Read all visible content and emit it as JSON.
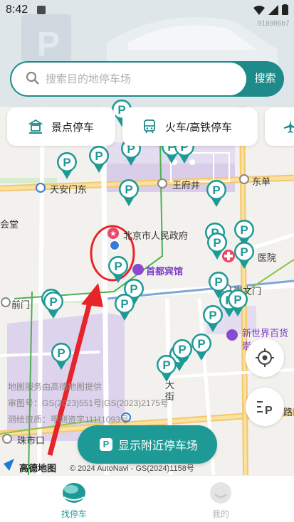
{
  "status_bar": {
    "time": "8:42"
  },
  "search": {
    "placeholder": "搜索目的地停车场",
    "button_label": "搜索"
  },
  "categories": [
    {
      "label": "景点停车",
      "icon": "landmark-icon"
    },
    {
      "label": "火车/高铁停车",
      "icon": "train-icon"
    },
    {
      "label": "",
      "icon": "airplane-icon"
    }
  ],
  "map": {
    "labels": {
      "tiananmen_east": "天安门东",
      "wangfujing": "王府井",
      "dongdan": "东单",
      "government": "北京市人民政府",
      "hotel": "首都宾馆",
      "hospital": "医院",
      "qianmen": "前门",
      "chongwenmen": "崇文门",
      "great_hall": "会堂",
      "new_world": "新世界百货",
      "store_sub": "崇",
      "zhushikou": "珠市口",
      "street": "大街",
      "road_right": "路口"
    },
    "attribution": {
      "line1": "地图服务由高德地图提供",
      "line2": "审图号：GS(2023)551号|GS(2023)2175号",
      "line3": "测绘资质：甲测资字11111093号",
      "brand": "高德地图",
      "copyright": "© 2024 AutoNavi - GS(2024)1158号"
    },
    "watermark": "918986b7"
  },
  "nearby_button": {
    "label": "显示附近停车场"
  },
  "tabs": [
    {
      "label": "找停车",
      "active": true
    },
    {
      "label": "我的",
      "active": false
    }
  ],
  "colors": {
    "brand": "#1e9a96",
    "search_bar": "#1e8a8a",
    "annotation_red": "#e8232a"
  }
}
